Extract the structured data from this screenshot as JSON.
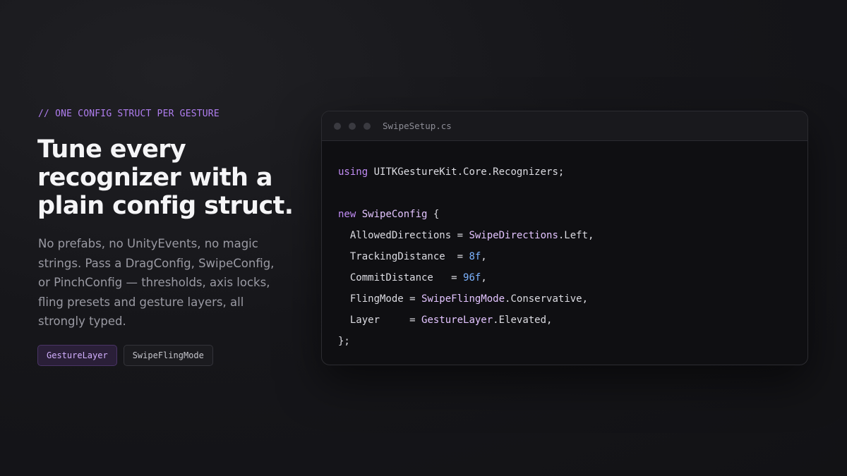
{
  "eyebrow": "// ONE CONFIG STRUCT PER GESTURE",
  "headline": {
    "lines": [
      "Tune every",
      "recognizer with a",
      "plain config struct."
    ]
  },
  "description": {
    "lines": [
      "No prefabs, no UnityEvents, no magic",
      "strings. Pass a DragConfig, SwipeConfig,",
      "or PinchConfig — thresholds, axis locks,",
      "fling presets and gesture layers, all",
      "strongly typed."
    ]
  },
  "chips": [
    {
      "label": "GestureLayer",
      "style": "accent"
    },
    {
      "label": "SwipeFlingMode",
      "style": "plain"
    }
  ],
  "editor": {
    "filename": "SwipeSetup.cs",
    "window_controls": [
      "window-dot-icon",
      "window-dot-icon",
      "window-dot-icon"
    ],
    "code_lines": [
      [
        {
          "t": "kw",
          "v": "using"
        },
        {
          "t": "plain",
          "v": " UITKGestureKit.Core.Recognizers;"
        }
      ],
      [],
      [
        {
          "t": "kw",
          "v": "new"
        },
        {
          "t": "plain",
          "v": " "
        },
        {
          "t": "type",
          "v": "SwipeConfig"
        },
        {
          "t": "plain",
          "v": " {"
        }
      ],
      [
        {
          "t": "plain",
          "v": "  AllowedDirections = "
        },
        {
          "t": "type",
          "v": "SwipeDirections"
        },
        {
          "t": "plain",
          "v": ".Left,"
        }
      ],
      [
        {
          "t": "plain",
          "v": "  TrackingDistance  = "
        },
        {
          "t": "num",
          "v": "8f"
        },
        {
          "t": "plain",
          "v": ","
        }
      ],
      [
        {
          "t": "plain",
          "v": "  CommitDistance   = "
        },
        {
          "t": "num",
          "v": "96f"
        },
        {
          "t": "plain",
          "v": ","
        }
      ],
      [
        {
          "t": "plain",
          "v": "  FlingMode = "
        },
        {
          "t": "type",
          "v": "SwipeFlingMode"
        },
        {
          "t": "plain",
          "v": ".Conservative,"
        }
      ],
      [
        {
          "t": "plain",
          "v": "  Layer     = "
        },
        {
          "t": "type",
          "v": "GestureLayer"
        },
        {
          "t": "plain",
          "v": ".Elevated,"
        }
      ],
      [
        {
          "t": "plain",
          "v": "};"
        }
      ]
    ]
  },
  "colors": {
    "accent": "#b07ef0",
    "keyword": "#c18cf5",
    "type": "#e3c4ff",
    "number": "#7cb3ff",
    "background": "#141417"
  }
}
